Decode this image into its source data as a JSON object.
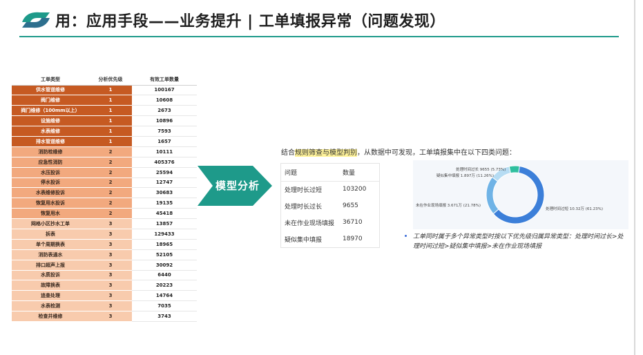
{
  "title": "用：应用手段——业务提升 | 工单填报异常（问题发现）",
  "colors": {
    "accent": "#1e9a8a",
    "priority1": "#c65a22",
    "priority2": "#f2a97e",
    "priority3": "#f8cbad",
    "arrow": "#1e9a8a"
  },
  "left_table": {
    "headers": [
      "工单类型",
      "分析优先级",
      "有效工单数量"
    ],
    "rows": [
      {
        "type": "供水管道维修",
        "priority": "1",
        "count": "100167"
      },
      {
        "type": "阀门维修",
        "priority": "1",
        "count": "10608"
      },
      {
        "type": "阀门维修（100mm以上）",
        "priority": "1",
        "count": "2673"
      },
      {
        "type": "设施维修",
        "priority": "1",
        "count": "10896"
      },
      {
        "type": "水表维修",
        "priority": "1",
        "count": "7593"
      },
      {
        "type": "排水管道维修",
        "priority": "1",
        "count": "1657"
      },
      {
        "type": "消防栓维修",
        "priority": "2",
        "count": "10111"
      },
      {
        "type": "应急性消防",
        "priority": "2",
        "count": "405376"
      },
      {
        "type": "水压投诉",
        "priority": "2",
        "count": "25594"
      },
      {
        "type": "停水投诉",
        "priority": "2",
        "count": "12747"
      },
      {
        "type": "水表维修投诉",
        "priority": "2",
        "count": "30683"
      },
      {
        "type": "恢复用水投诉",
        "priority": "2",
        "count": "19135"
      },
      {
        "type": "恢复用水",
        "priority": "2",
        "count": "45418"
      },
      {
        "type": "网格小区抄水工单",
        "priority": "3",
        "count": "13857"
      },
      {
        "type": "拆表",
        "priority": "3",
        "count": "129433"
      },
      {
        "type": "单个周期换表",
        "priority": "3",
        "count": "18965"
      },
      {
        "type": "消防表通水",
        "priority": "3",
        "count": "52105"
      },
      {
        "type": "排口超声上报",
        "priority": "3",
        "count": "30092"
      },
      {
        "type": "水质投诉",
        "priority": "3",
        "count": "6440"
      },
      {
        "type": "故障换表",
        "priority": "3",
        "count": "20223"
      },
      {
        "type": "追查处理",
        "priority": "3",
        "count": "14764"
      },
      {
        "type": "水表检测",
        "priority": "3",
        "count": "7035"
      },
      {
        "type": "检查井维修",
        "priority": "3",
        "count": "3743"
      }
    ]
  },
  "arrow_label": "模型分析",
  "intro": {
    "prefix": "结合",
    "highlight": "规则筛查与模型判别",
    "suffix": "，从数据中可发现，工单填报集中在以下四类问题："
  },
  "issue_table": {
    "headers": [
      "问题",
      "数量"
    ],
    "rows": [
      {
        "issue": "处理时长过短",
        "count": "103200"
      },
      {
        "issue": "处理时长过长",
        "count": "9655"
      },
      {
        "issue": "未在作业现场填报",
        "count": "36710"
      },
      {
        "issue": "疑似集中填报",
        "count": "18970"
      }
    ]
  },
  "chart_data": {
    "type": "pie",
    "categories": [
      "处理时间过短",
      "未在作业现场填报",
      "疑似集中填报",
      "处理时间过长"
    ],
    "values": [
      61.23,
      21.78,
      11.26,
      5.73
    ],
    "labels": [
      "处理时间过短 10.32万 (61.23%)",
      "未在作业现场填报 3.671万 (21.78%)",
      "疑似集中填报 1.897万 (11.26%)",
      "处理时间过长 9655 (5.73%)"
    ],
    "colors": [
      "#3c7fd9",
      "#6fb3e6",
      "#b6dcf3",
      "#2fbf9f"
    ]
  },
  "note": "工单同时属于多个异常类型时按以下优先级归属异常类型：处理时间过长>处理时间过短>疑似集中填报>未在作业现场填报"
}
